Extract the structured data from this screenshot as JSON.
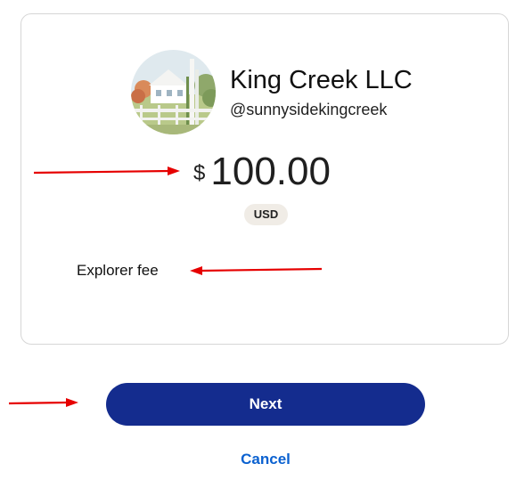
{
  "merchant": {
    "name": "King Creek LLC",
    "handle": "@sunnysidekingcreek"
  },
  "payment": {
    "currency_symbol": "$",
    "amount": "100.00",
    "currency_code": "USD",
    "fee_label": "Explorer fee"
  },
  "actions": {
    "next_label": "Next",
    "cancel_label": "Cancel"
  },
  "colors": {
    "primary_button": "#142c8e",
    "cancel_link": "#0a61d0",
    "annotation_arrow": "#e60000"
  }
}
